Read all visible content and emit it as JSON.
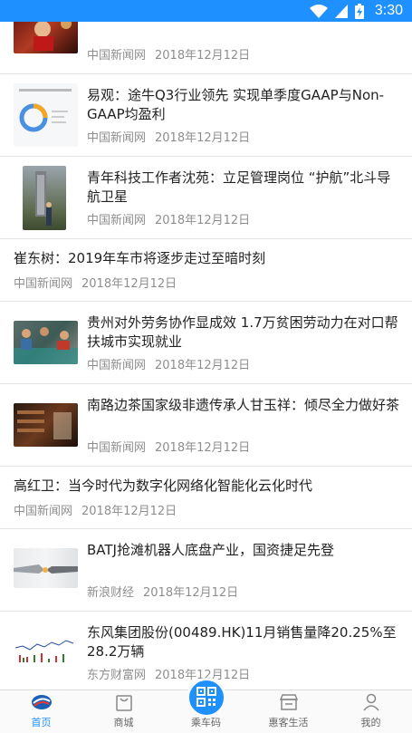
{
  "status_bar": {
    "time": "3:30"
  },
  "feed": {
    "items": [
      {
        "title": "",
        "source": "中国新闻网",
        "date": "2018年12月12日"
      },
      {
        "title": "易观：途牛Q3行业领先 实现单季度GAAP与Non-GAAP均盈利",
        "source": "中国新闻网",
        "date": "2018年12月12日"
      },
      {
        "title": "青年科技工作者沈苑：立足管理岗位 “护航”北斗导航卫星",
        "source": "中国新闻网",
        "date": "2018年12月12日"
      },
      {
        "title": "崔东树：2019年车市将逐步走过至暗时刻",
        "source": "中国新闻网",
        "date": "2018年12月12日"
      },
      {
        "title": "贵州对外劳务协作显成效 1.7万贫困劳动力在对口帮扶城市实现就业",
        "source": "中国新闻网",
        "date": "2018年12月12日"
      },
      {
        "title": "南路边茶国家级非遗传承人甘玉祥：倾尽全力做好茶",
        "source": "中国新闻网",
        "date": "2018年12月12日"
      },
      {
        "title": "高红卫：当今时代为数字化网络化智能化云化时代",
        "source": "中国新闻网",
        "date": "2018年12月12日"
      },
      {
        "title": "BATJ抢滩机器人底盘产业，国资捷足先登",
        "source": "新浪财经",
        "date": "2018年12月12日"
      },
      {
        "title": "东风集团股份(00489.HK)11月销售量降20.25%至28.2万辆",
        "source": "东方财富网",
        "date": "2018年12月12日"
      }
    ]
  },
  "tab_bar": {
    "tabs": [
      {
        "label": "首页",
        "icon": "home-icon",
        "active": true
      },
      {
        "label": "商城",
        "icon": "shop-bag-icon",
        "active": false
      },
      {
        "label": "乘车码",
        "icon": "qr-code-icon",
        "active": false
      },
      {
        "label": "惠客生活",
        "icon": "store-icon",
        "active": false
      },
      {
        "label": "我的",
        "icon": "profile-icon",
        "active": false
      }
    ]
  },
  "colors": {
    "accent": "#1e90ff",
    "meta_text": "#8e8e8e",
    "title_text": "#222222"
  }
}
